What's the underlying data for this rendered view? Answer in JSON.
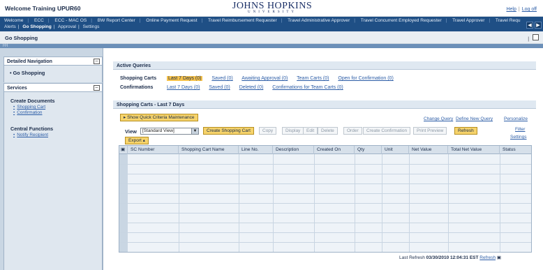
{
  "header": {
    "welcome": "Welcome Training UPUR60",
    "logo_line1": "JOHNS HOPKINS",
    "logo_line2": "UNIVERSITY",
    "help": "Help",
    "logoff": "Log off"
  },
  "topnav": {
    "tabs": [
      "Welcome",
      "ECC",
      "ECC - MAC OS",
      "BW Report Center",
      "Online Payment Request",
      "Travel Reimbursement Requester",
      "Travel Administrative Approver",
      "Travel Concurrent Employed Requester",
      "Travel Approver",
      "Travel Requ"
    ],
    "subtabs": [
      "Alerts",
      "Go Shopping",
      "Approval",
      "Settings"
    ],
    "active_subtab": "Go Shopping"
  },
  "titlebar": {
    "title": "Go Shopping",
    "strip_text": "|‹|›|"
  },
  "sidebar": {
    "detailed_nav_title": "Detailed Navigation",
    "nav_items": [
      "Go Shopping"
    ],
    "services_title": "Services",
    "groups": [
      {
        "title": "Create Documents",
        "links": [
          "Shopping Cart",
          "Confirmation"
        ]
      },
      {
        "title": "Central Functions",
        "links": [
          "Notify Recipient"
        ]
      }
    ]
  },
  "active_queries": {
    "title": "Active Queries",
    "rows": [
      {
        "label": "Shopping Carts",
        "links": [
          "Last 7 Days (0)",
          "Saved (0)",
          "Awaiting Approval (0)",
          "Team Carts (0)",
          "Open for Confirmation (0)"
        ]
      },
      {
        "label": "Confirmations",
        "links": [
          "Last 7 Days (0)",
          "Saved (0)",
          "Deleted (0)",
          "Confirmations for Team Carts (0)"
        ]
      }
    ]
  },
  "carts": {
    "title": "Shopping Carts - Last 7 Days",
    "quick_criteria": "Show Quick Criteria Maintenance",
    "right_links": [
      "Change Query",
      "Define New Query",
      "Personalize"
    ],
    "view_label": "View",
    "view_value": "[Standard View]",
    "buttons": {
      "create": "Create Shopping Cart",
      "copy": "Copy",
      "display": "Display",
      "edit": "Edit",
      "delete": "Delete",
      "order": "Order",
      "create_confirmation": "Create Confirmation",
      "print_preview": "Print Preview",
      "refresh": "Refresh",
      "export": "Export",
      "filter": "Filter",
      "settings": "Settings"
    },
    "columns": [
      "SC Number",
      "Shopping Cart Name",
      "Line No.",
      "Description",
      "Created On",
      "Qty",
      "Unit",
      "Net Value",
      "Total Net Value",
      "Status"
    ],
    "footer": {
      "label": "Last Refresh",
      "timestamp": "03/30/2010 12:04:31 EST",
      "refresh_link": "Refresh"
    }
  }
}
